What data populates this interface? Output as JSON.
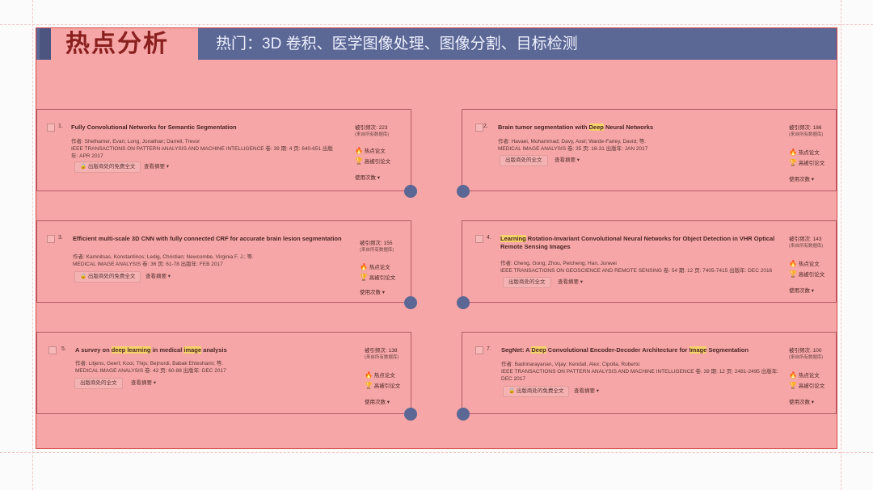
{
  "header": {
    "title": "热点分析",
    "subtitle": "热门：3D 卷积、医学图像处理、图像分割、目标检测"
  },
  "labels": {
    "cited_prefix": "被引频次:",
    "cited_note": "(来自所有数据库)",
    "hot": "热点论文",
    "highly_cited": "高被引论文",
    "usage": "使用次数",
    "abstract": "查看摘要",
    "free_fulltext": "出版商处的免费全文",
    "fulltext": "出版商处的全文"
  },
  "papers": [
    {
      "num": "1.",
      "title": "Fully Convolutional Networks for Semantic Segmentation",
      "title_hl": [],
      "authors": "作者: Shelhamer, Evan; Long, Jonathan; Darrell, Trevor",
      "journal": "IEEE TRANSACTIONS ON PATTERN ANALYSIS AND MACHINE INTELLIGENCE 卷: 39 期: 4 页: 640-651 出版年: APR 2017",
      "fulltext": "出版商处的免费全文",
      "cited": "223"
    },
    {
      "num": "2.",
      "title_parts": [
        "Brain tumor segmentation with ",
        "Deep",
        " Neural Networks"
      ],
      "authors": "作者: Havaei, Mohammad; Davy, Axel; Warde-Farley, David; 等.",
      "journal": "MEDICAL IMAGE ANALYSIS 卷: 35 页: 18-31 出版年: JAN 2017",
      "fulltext": "出版商处的全文",
      "cited": "186"
    },
    {
      "num": "3.",
      "title": "Efficient multi-scale 3D CNN with fully connected CRF for accurate brain lesion segmentation",
      "authors": "作者: Kamnitsas, Konstantinos; Ledig, Christian; Newcombe, Virginia F. J.; 等.",
      "journal": "MEDICAL IMAGE ANALYSIS 卷: 36 页: 61-78 出版年: FEB 2017",
      "fulltext": "出版商处的免费全文",
      "cited": "155"
    },
    {
      "num": "4.",
      "title_parts": [
        "Learning",
        " Rotation-Invariant Convolutional Neural Networks for Object Detection in VHR Optical Remote Sensing Images"
      ],
      "authors": "作者: Cheng, Gong; Zhou, Peicheng; Han, Junwei",
      "journal": "IEEE TRANSACTIONS ON GEOSCIENCE AND REMOTE SENSING 卷: 54 期: 12 页: 7405-7415 出版年: DEC 2016",
      "fulltext": "出版商处的全文",
      "cited": "143"
    },
    {
      "num": "5.",
      "title_parts": [
        "A survey on ",
        "deep learning",
        " in medical ",
        "image",
        " analysis"
      ],
      "authors": "作者: Litjens, Geert; Kooi, Thijs; Bejnordi, Babak Ehteshami; 等.",
      "journal": "MEDICAL IMAGE ANALYSIS 卷: 42 页: 60-88 出版年: DEC 2017",
      "fulltext": "出版商处的全文",
      "cited": "138"
    },
    {
      "num": "7.",
      "title_parts": [
        "SegNet: A ",
        "Deep",
        " Convolutional Encoder-Decoder Architecture for ",
        "Image",
        " Segmentation"
      ],
      "authors": "作者: Badrinarayanan, Vijay; Kendall, Alex; Cipolla, Roberto",
      "journal": "IEEE TRANSACTIONS ON PATTERN ANALYSIS AND MACHINE INTELLIGENCE 卷: 39 期: 12 页: 2481-2495 出版年: DEC 2017",
      "fulltext": "出版商处的免费全文",
      "cited": "100"
    }
  ],
  "colors": {
    "slide_bg": "#f6a6a6",
    "header_bar": "#5b6794",
    "title_text": "#8a1f1f",
    "highlight": "#f6d26a",
    "dot": "#5b6794"
  }
}
